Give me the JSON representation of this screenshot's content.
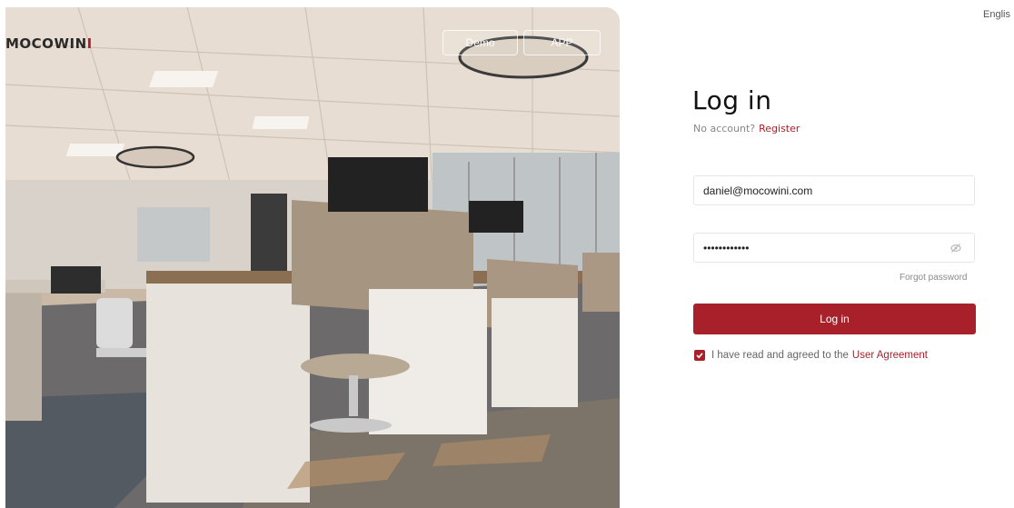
{
  "hero": {
    "brand_prefix": "MOCOWIN",
    "brand_suffix": "I",
    "demo_label": "Demo",
    "app_label": "APP"
  },
  "language_label": "English",
  "login": {
    "title": "Log in",
    "no_account_text": "No account?",
    "register_link": "Register",
    "email_value": "daniel@mocowini.com",
    "password_value": "••••••••••••",
    "forgot_password": "Forgot password",
    "submit_label": "Log in",
    "agreement_text": "I have read and agreed to the",
    "agreement_link": "User Agreement",
    "agreement_checked": true
  },
  "icons": {
    "password_toggle": "eye-slash-icon",
    "agreement_checkbox": "checkmark-icon"
  },
  "colors": {
    "brand_red": "#a8202a"
  }
}
